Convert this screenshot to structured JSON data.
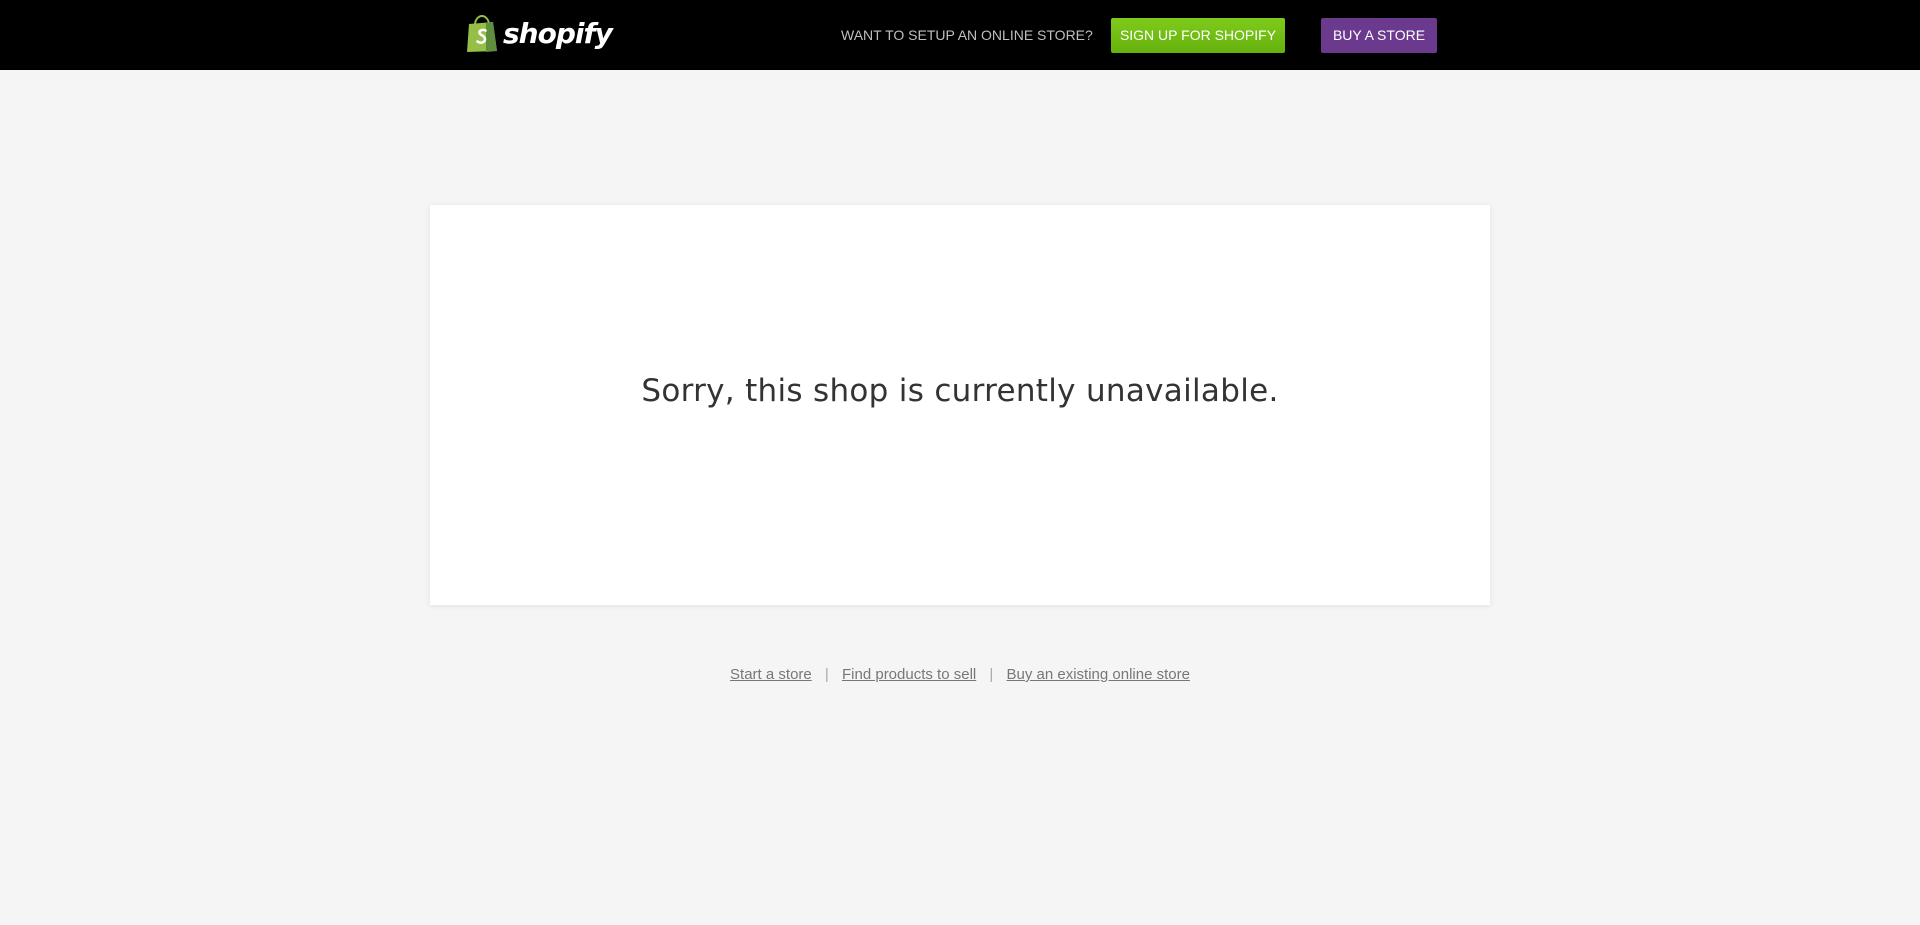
{
  "header": {
    "logo_text": "shopify",
    "logo_icon": "shopping-bag-icon",
    "prompt": "WANT TO SETUP AN ONLINE STORE?",
    "signup_label": "SIGN UP FOR SHOPIFY",
    "buy_label": "BUY A STORE"
  },
  "main": {
    "message": "Sorry, this shop is currently unavailable."
  },
  "footer": {
    "links": [
      {
        "label": "Start a store"
      },
      {
        "label": "Find products to sell"
      },
      {
        "label": "Buy an existing online store"
      }
    ],
    "separator": "|"
  },
  "colors": {
    "header_bg": "#000000",
    "page_bg": "#f5f5f5",
    "signup_green": "#6fbd12",
    "buy_purple": "#6b3a8e",
    "logo_green": "#95bf47"
  }
}
